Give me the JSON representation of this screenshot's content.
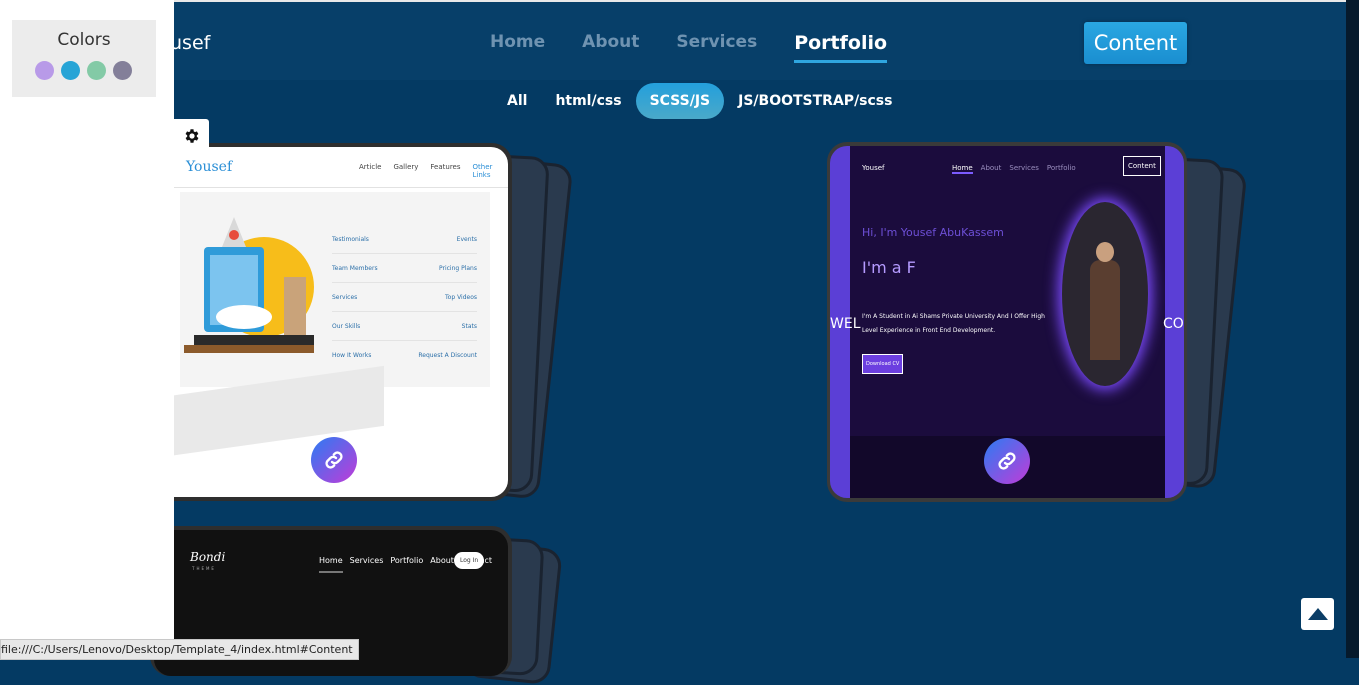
{
  "navbar": {
    "brand": "usef",
    "links": [
      {
        "label": "Home",
        "active": false
      },
      {
        "label": "About",
        "active": false
      },
      {
        "label": "Services",
        "active": false
      },
      {
        "label": "Portfolio",
        "active": true
      }
    ],
    "cta_label": "Content"
  },
  "filters": [
    {
      "label": "All",
      "active": false
    },
    {
      "label": "html/css",
      "active": false
    },
    {
      "label": "SCSS/JS",
      "active": true
    },
    {
      "label": "JS/BOOTSTRAP/scss",
      "active": false
    }
  ],
  "side_panel": {
    "title": "Colors",
    "swatches": [
      "#b89ae8",
      "#27a4d6",
      "#83caa6",
      "#837f99"
    ],
    "gear_icon": "gear-icon"
  },
  "projects": [
    {
      "name": "yousef-landing",
      "logo": "Yousef",
      "nav": [
        "Article",
        "Gallery",
        "Features",
        "Other Links"
      ],
      "links": [
        [
          "Testimonials",
          "Events"
        ],
        [
          "Team Members",
          "Pricing Plans"
        ],
        [
          "Services",
          "Top Videos"
        ],
        [
          "Our Skills",
          "Stats"
        ],
        [
          "How It Works",
          "Request A Discount"
        ]
      ],
      "link_icon": "link-icon"
    },
    {
      "name": "yousef-portfolio",
      "logo": "Yousef",
      "nav": [
        "Home",
        "About",
        "Services",
        "Portfolio"
      ],
      "button": "Content",
      "greeting": "Hi, I'm Yousef AbuKassem",
      "typed": "I'm a F",
      "bio": "I'm A Student in Ai Shams Private University And I Offer High Level Experience in Front End Development.",
      "cta": "Download CV",
      "left_edge_text": "WEL",
      "right_edge_text": "COM",
      "link_icon": "link-icon"
    },
    {
      "name": "bondi-theme",
      "logo": "Bondi",
      "logo_sub": "THEME",
      "nav": [
        "Home",
        "Services",
        "Portfolio",
        "About",
        "Contact"
      ],
      "login": "Log In"
    }
  ],
  "status_bar": "file:///C:/Users/Lenovo/Desktop/Template_4/index.html#Content",
  "scroll_top_icon": "arrow-up-icon"
}
